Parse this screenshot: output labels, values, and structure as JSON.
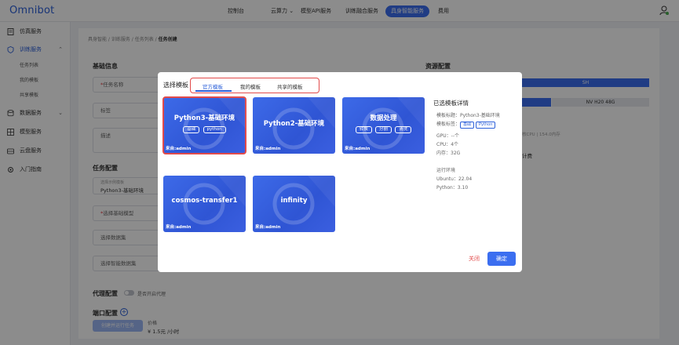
{
  "app": {
    "logo": "Omnibot"
  },
  "topnav": [
    {
      "label": "控制台"
    },
    {
      "label": "云算力"
    },
    {
      "label": "模型API服务"
    },
    {
      "label": "训练融合服务"
    },
    {
      "label": "具身智能服务"
    },
    {
      "label": "费用"
    }
  ],
  "sidebar": {
    "items": [
      {
        "label": "仿真服务",
        "icon": "doc-icon"
      },
      {
        "label": "训练服务",
        "icon": "shield-icon"
      },
      {
        "label": "数据服务",
        "icon": "database-icon"
      },
      {
        "label": "模型服务",
        "icon": "model-icon"
      },
      {
        "label": "云盘服务",
        "icon": "disk-icon"
      },
      {
        "label": "入门指南",
        "icon": "gear-icon"
      }
    ],
    "sub_items": [
      "任务列表",
      "我的模板",
      "共享模板"
    ]
  },
  "breadcrumb": {
    "a": "具身智能",
    "b": "训练服务",
    "c": "任务列表",
    "current": "任务创建"
  },
  "form": {
    "basic_title": "基础信息",
    "task_name_ph": "任务名称",
    "tags_ph": "标签",
    "desc_ph": "描述",
    "task_config_title": "任务配置",
    "template_label": "选择示例模板",
    "template_value": "Python3-基础环境",
    "base_model_ph": "选择基础模型",
    "dataset_ph": "选择数据集",
    "smart_dataset_ph": "选择智能数据集",
    "proxy_title": "代理配置",
    "proxy_toggle": "是否开启代理",
    "port_title": "端口配置",
    "run_button": "创建并运行任务",
    "price_label": "价格",
    "price_value": "¥ 1.5元 /小时"
  },
  "resource": {
    "title": "资源配置",
    "region": "SH",
    "gpu": "NV H20 48G",
    "spec_note": "核CPU | 154.0内存",
    "billing": "计费"
  },
  "modal": {
    "title": "选择模板",
    "tabs": [
      "官方模板",
      "我的模板",
      "共享的模板"
    ],
    "cards": [
      {
        "name": "Python3-基础环境",
        "tags": [
          "基础",
          "python"
        ],
        "source": "来自:admin"
      },
      {
        "name": "Python2-基础环境",
        "tags": [],
        "source": "来自:admin"
      },
      {
        "name": "数据处理",
        "tags": [
          "转换",
          "分割",
          "清洗"
        ],
        "source": "来自:admin"
      },
      {
        "name": "cosmos-transfer1",
        "tags": [],
        "source": "来自:admin"
      },
      {
        "name": "infinity",
        "tags": [],
        "source": "来自:admin"
      }
    ],
    "detail": {
      "title": "已选模板详情",
      "name_line": "模板标题：Python3-基础环境",
      "tags_label": "模板标签：",
      "tags": [
        "基础",
        "Python"
      ],
      "gpu": "GPU：--个",
      "cpu": "CPU：4个",
      "mem": "内存：32G",
      "env_title": "运行环境",
      "ubuntu": "Ubuntu：22.04",
      "python": "Python：3.10"
    },
    "close": "关闭",
    "confirm": "确定"
  },
  "colors": {
    "primary": "#3b6ef0",
    "danger": "#e24a4a",
    "card": "#3560dc"
  }
}
